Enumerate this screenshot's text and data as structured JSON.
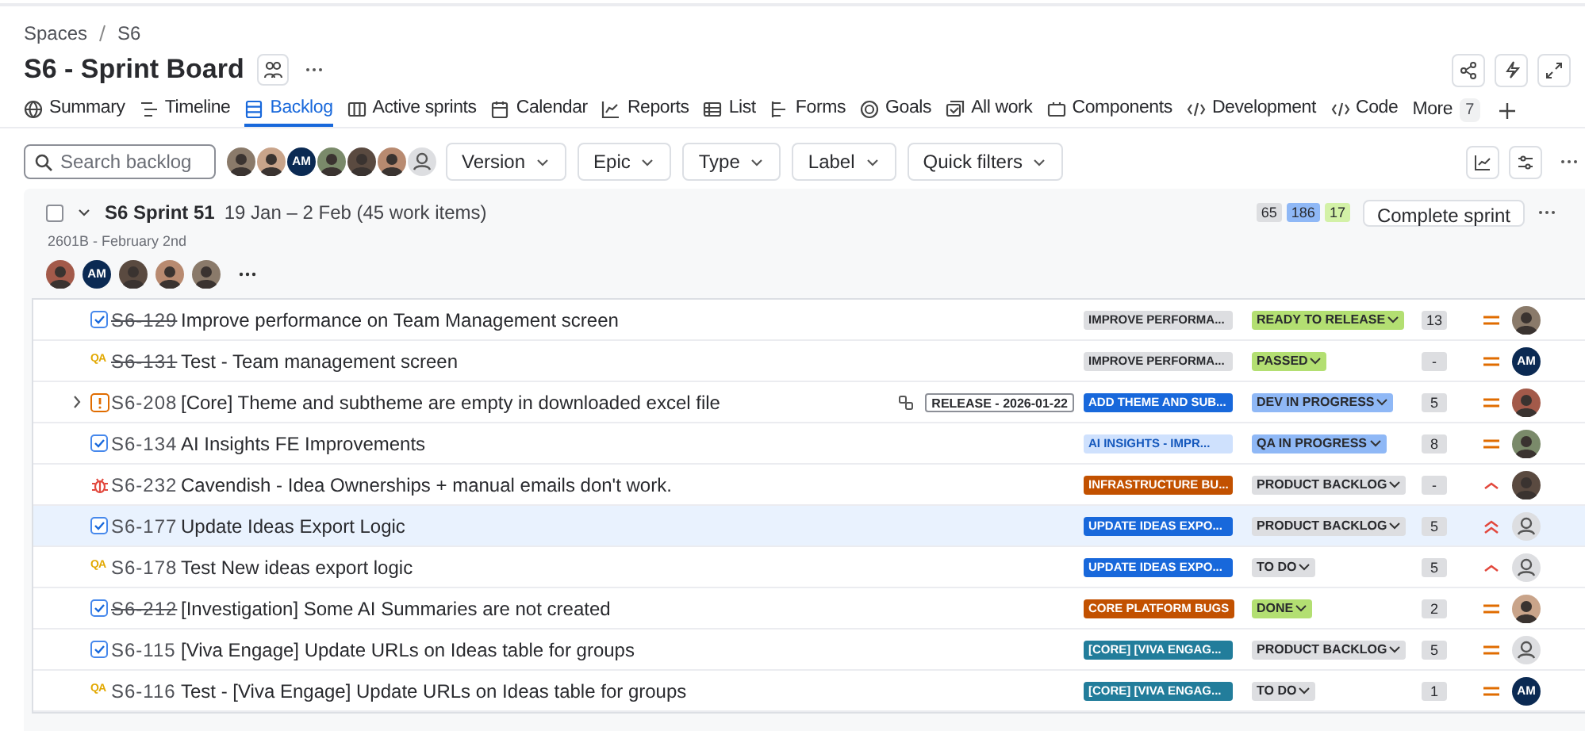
{
  "breadcrumb": [
    "Spaces",
    "S6"
  ],
  "title": "S6 - Sprint Board",
  "tabs": [
    {
      "label": "Summary",
      "selected": false
    },
    {
      "label": "Timeline",
      "selected": false
    },
    {
      "label": "Backlog",
      "selected": true
    },
    {
      "label": "Active sprints",
      "selected": false
    },
    {
      "label": "Calendar",
      "selected": false
    },
    {
      "label": "Reports",
      "selected": false
    },
    {
      "label": "List",
      "selected": false
    },
    {
      "label": "Forms",
      "selected": false
    },
    {
      "label": "Goals",
      "selected": false
    },
    {
      "label": "All work",
      "selected": false
    },
    {
      "label": "Components",
      "selected": false
    },
    {
      "label": "Development",
      "selected": false
    },
    {
      "label": "Code",
      "selected": false
    }
  ],
  "more_tab": {
    "label": "More",
    "count": "7"
  },
  "search": {
    "placeholder": "Search backlog"
  },
  "people": [
    {
      "kind": "photo"
    },
    {
      "kind": "photo"
    },
    {
      "kind": "initials",
      "initials": "AM"
    },
    {
      "kind": "photo"
    },
    {
      "kind": "photo"
    },
    {
      "kind": "photo"
    },
    {
      "kind": "unassigned"
    }
  ],
  "filters": [
    "Version",
    "Epic",
    "Type",
    "Label",
    "Quick filters"
  ],
  "sprint": {
    "checked": false,
    "name": "S6 Sprint 51",
    "dates": "19 Jan – 2 Feb (45 work items)",
    "goal": "2601B - February 2nd",
    "expanded": true,
    "members": [
      {
        "kind": "photo"
      },
      {
        "kind": "initials",
        "initials": "AM"
      },
      {
        "kind": "photo"
      },
      {
        "kind": "photo"
      },
      {
        "kind": "photo"
      }
    ],
    "counts": [
      {
        "value": "65",
        "color": "#dddee1"
      },
      {
        "value": "186",
        "color": "#8fb8f6"
      },
      {
        "value": "17",
        "color": "#d3f1a7"
      }
    ],
    "complete_button": "Complete sprint"
  },
  "issues": [
    {
      "kind": "task",
      "key": "S6-129",
      "done": true,
      "summary": "Improve performance on Team Management screen",
      "epic": {
        "label": "IMPROVE PERFORMA...",
        "color": "#dddee1"
      },
      "status": {
        "label": "READY TO RELEASE",
        "color": "#b3df72"
      },
      "estimate": "13",
      "priority": {
        "kind": "medium"
      },
      "assignee": {
        "kind": "photo"
      },
      "selected": false
    },
    {
      "kind": "test",
      "type_text": "QA",
      "key": "S6-131",
      "done": true,
      "summary": "Test - Team management screen",
      "epic": {
        "label": "IMPROVE PERFORMA...",
        "color": "#dddee1"
      },
      "status": {
        "label": "PASSED",
        "color": "#b3df72"
      },
      "estimate": "-",
      "priority": {
        "kind": "medium"
      },
      "assignee": {
        "kind": "initials",
        "initials": "AM"
      },
      "selected": false
    },
    {
      "kind": "incident",
      "key": "S6-208",
      "done": false,
      "has_children": true,
      "summary": "[Core] Theme and subtheme are empty in downloaded excel file",
      "release": "RELEASE - 2026-01-22",
      "epic": {
        "label": "ADD THEME AND SUB...",
        "color": "#1868db"
      },
      "status": {
        "label": "DEV IN PROGRESS",
        "color": "#8fb8f6"
      },
      "estimate": "5",
      "priority": {
        "kind": "medium"
      },
      "assignee": {
        "kind": "photo"
      },
      "selected": false
    },
    {
      "kind": "task",
      "key": "S6-134",
      "done": false,
      "summary": "AI Insights FE Improvements",
      "epic": {
        "label": "AI INSIGHTS - IMPR...",
        "color": "#cfe1fd"
      },
      "status": {
        "label": "QA IN PROGRESS",
        "color": "#8fb8f6"
      },
      "estimate": "8",
      "priority": {
        "kind": "medium"
      },
      "assignee": {
        "kind": "photo"
      },
      "selected": false
    },
    {
      "kind": "bug",
      "key": "S6-232",
      "done": false,
      "summary": "Cavendish - Idea Ownerships + manual emails don't work.",
      "epic": {
        "label": "INFRASTRUCTURE BU...",
        "color": "#c25100"
      },
      "status": {
        "label": "PRODUCT BACKLOG",
        "color": "#dddee1"
      },
      "estimate": "-",
      "priority": {
        "kind": "high"
      },
      "assignee": {
        "kind": "photo"
      },
      "selected": false
    },
    {
      "kind": "task",
      "key": "S6-177",
      "done": false,
      "summary": "Update Ideas Export Logic",
      "epic": {
        "label": "UPDATE IDEAS EXPO...",
        "color": "#1868db"
      },
      "status": {
        "label": "PRODUCT BACKLOG",
        "color": "#dddee1"
      },
      "estimate": "5",
      "priority": {
        "kind": "highest"
      },
      "assignee": {
        "kind": "unassigned"
      },
      "selected": true
    },
    {
      "kind": "test",
      "type_text": "QA",
      "key": "S6-178",
      "done": false,
      "summary": "Test New ideas export logic",
      "epic": {
        "label": "UPDATE IDEAS EXPO...",
        "color": "#1868db"
      },
      "status": {
        "label": "TO DO",
        "color": "#dddee1"
      },
      "estimate": "5",
      "priority": {
        "kind": "high"
      },
      "assignee": {
        "kind": "unassigned"
      },
      "selected": false
    },
    {
      "kind": "task",
      "key": "S6-212",
      "done": true,
      "summary": "[Investigation] Some AI Summaries are not created",
      "epic": {
        "label": "CORE PLATFORM BUGS",
        "color": "#c25100"
      },
      "status": {
        "label": "DONE",
        "color": "#b3df72"
      },
      "estimate": "2",
      "priority": {
        "kind": "medium"
      },
      "assignee": {
        "kind": "photo"
      },
      "selected": false
    },
    {
      "kind": "task",
      "key": "S6-115",
      "done": false,
      "summary": "[Viva Engage] Update URLs on Ideas table for groups",
      "epic": {
        "label": "[CORE] [VIVA ENGAG...",
        "color": "#227d9b"
      },
      "status": {
        "label": "PRODUCT BACKLOG",
        "color": "#dddee1"
      },
      "estimate": "5",
      "priority": {
        "kind": "medium"
      },
      "assignee": {
        "kind": "unassigned"
      },
      "selected": false
    },
    {
      "kind": "test",
      "type_text": "QA",
      "key": "S6-116",
      "done": false,
      "summary": "Test - [Viva Engage] Update URLs on Ideas table for groups",
      "epic": {
        "label": "[CORE] [VIVA ENGAG...",
        "color": "#227d9b"
      },
      "status": {
        "label": "TO DO",
        "color": "#dddee1"
      },
      "estimate": "1",
      "priority": {
        "kind": "medium"
      },
      "assignee": {
        "kind": "initials",
        "initials": "AM"
      },
      "selected": false
    }
  ]
}
